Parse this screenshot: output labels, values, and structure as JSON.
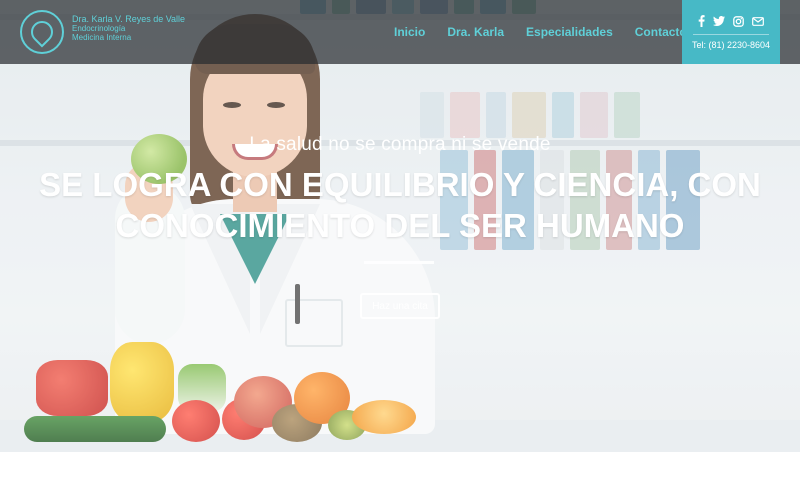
{
  "brand": {
    "name": "Dra. Karla V. Reyes de Valle",
    "line2": "Endocrinología",
    "line3": "Medicina Interna"
  },
  "nav": {
    "items": [
      {
        "label": "Inicio"
      },
      {
        "label": "Dra. Karla"
      },
      {
        "label": "Especialidades"
      },
      {
        "label": "Contacto"
      }
    ]
  },
  "contact": {
    "phone": "Tel: (81) 2230-8604",
    "social_icons": [
      "facebook-icon",
      "twitter-icon",
      "instagram-icon",
      "email-icon"
    ]
  },
  "hero": {
    "tagline": "La salud no se compra ni se vende",
    "headline_line1": "SE LOGRA CON EQUILIBRIO Y CIENCIA, CON",
    "headline_line2": "CONOCIMIENTO DEL SER HUMANO",
    "cta_label": "Haz una cita"
  },
  "colors": {
    "accent": "#5fd0d8",
    "contact_box": "#47b9c6",
    "header_bg": "rgba(40,44,48,0.72)"
  }
}
